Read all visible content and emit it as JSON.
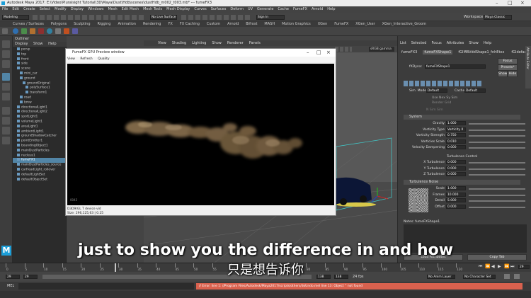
{
  "window": {
    "title": "Autodesk Maya 2017: E:\\Video\\Pluralsight Tutorial\\3D\\Maya\\Dust\\Hdb\\scenes\\dustHdb_m002_t003.mb* --- fumeFX3"
  },
  "menubar": {
    "items": [
      "File",
      "Edit",
      "Create",
      "Select",
      "Modify",
      "Display",
      "Windows",
      "Mesh",
      "Edit Mesh",
      "Mesh Tools",
      "Mesh Display",
      "Curves",
      "Surfaces",
      "Deform",
      "UV",
      "Generate",
      "Cache",
      "FumeFX",
      "Arnold",
      "Help"
    ],
    "workspace_label": "Workspace :",
    "workspace_value": "Maya Classic"
  },
  "statusline": {
    "mode": "Modeling",
    "live_surface": "No Live Surface",
    "sign_in": "Sign In"
  },
  "shelf": {
    "tabs": [
      "Curves / Surfaces",
      "Polygons",
      "Sculpting",
      "Rigging",
      "Animation",
      "Rendering",
      "FX",
      "FX Caching",
      "Custom",
      "Arnold",
      "Bifrost",
      "MASH",
      "Motion Graphics",
      "XGen",
      "FumeFX",
      "XGen_User",
      "XGen_Interactive_Groom"
    ]
  },
  "outliner": {
    "title": "Outliner",
    "menu": [
      "Display",
      "Show",
      "Help"
    ],
    "rows": [
      {
        "label": "persp",
        "indent": 1,
        "selected": false
      },
      {
        "label": "top",
        "indent": 1,
        "selected": false
      },
      {
        "label": "front",
        "indent": 1,
        "selected": false
      },
      {
        "label": "side",
        "indent": 1,
        "selected": false
      },
      {
        "label": "scene",
        "indent": 1,
        "selected": false
      },
      {
        "label": "mini_car",
        "indent": 2,
        "selected": false
      },
      {
        "label": "ground",
        "indent": 2,
        "selected": false
      },
      {
        "label": "groundOriginal",
        "indent": 3,
        "selected": false
      },
      {
        "label": "polySurface1",
        "indent": 4,
        "selected": false
      },
      {
        "label": "transform1",
        "indent": 4,
        "selected": false
      },
      {
        "label": "road",
        "indent": 2,
        "selected": false
      },
      {
        "label": "bmw",
        "indent": 2,
        "selected": false
      },
      {
        "label": "directionalLight1",
        "indent": 1,
        "selected": false
      },
      {
        "label": "directionalLight2",
        "indent": 1,
        "selected": false
      },
      {
        "label": "spotLight1",
        "indent": 1,
        "selected": false
      },
      {
        "label": "volumeLight1",
        "indent": 1,
        "selected": false
      },
      {
        "label": "areaLight1",
        "indent": 1,
        "selected": false
      },
      {
        "label": "ambientLight1",
        "indent": 1,
        "selected": false
      },
      {
        "label": "groundShadowCatcher",
        "indent": 1,
        "selected": false
      },
      {
        "label": "pointEmitter1",
        "indent": 1,
        "selected": false
      },
      {
        "label": "boundingObject1",
        "indent": 1,
        "selected": false
      },
      {
        "label": "mainDustParticles",
        "indent": 1,
        "selected": false
      },
      {
        "label": "nucleus1",
        "indent": 1,
        "selected": false
      },
      {
        "label": "fumeFX1",
        "indent": 1,
        "selected": true
      },
      {
        "label": "mainDustParticles_source",
        "indent": 1,
        "selected": false
      },
      {
        "label": "carHeadLight_rollover",
        "indent": 1,
        "selected": false
      },
      {
        "label": "defaultLightSet",
        "indent": 1,
        "selected": false
      },
      {
        "label": "defaultObjectSet",
        "indent": 1,
        "selected": false
      }
    ]
  },
  "viewport": {
    "menu": [
      "View",
      "Shading",
      "Lighting",
      "Show",
      "Renderer",
      "Panels"
    ],
    "badge": "sRGB gamma"
  },
  "preview": {
    "title": "FumeFX GPU Preview window",
    "menu": [
      "View",
      "Refresh",
      "Quality"
    ],
    "frame_label": "0043",
    "device": "D3D9/GL T device vid",
    "size": "Size: 296,125,63 | 0.25"
  },
  "attr": {
    "menu": [
      "List",
      "Selected",
      "Focus",
      "Attributes",
      "Show",
      "Help"
    ],
    "tabs": [
      "fumeFX3",
      "fumeFXShape1",
      "fGIMBVddShape1_fnhEtxx",
      "fGIdefaultMultfwdsx"
    ],
    "node_label": "fXDyna:",
    "node_value": "fumeFXShape1",
    "focus_btn": "Focus",
    "presets_btn": "Presets*",
    "show_btn": "Show",
    "hide_btn": "Hide",
    "side_tab": "Attribute Editor",
    "sim_mode_label": "Sim. Mode",
    "sim_mode_value": "Default",
    "cache_label": "Cache",
    "cache_value": "Default",
    "use_nex_label": "Use Nex Sy Sim",
    "render_grid_label": "Render Grid",
    "nex_sim_label": "N Sim Sim",
    "section_system": "System",
    "system_rows": [
      {
        "label": "Gravity",
        "value": "1.000"
      },
      {
        "label": "Vorticity Type",
        "value": "Vorticity II"
      },
      {
        "label": "Vorticity Strength",
        "value": "0.750"
      },
      {
        "label": "Vorticies Scale",
        "value": "0.010"
      },
      {
        "label": "Velocity Dampening",
        "value": "0.000"
      }
    ],
    "turbulence_noise_cb": "Turbulence Control",
    "turbulence_rows": [
      {
        "label": "X Turbulence",
        "value": "0.000"
      },
      {
        "label": "Y Turbulence",
        "value": "0.000"
      },
      {
        "label": "Z Turbulence",
        "value": "0.000"
      }
    ],
    "section_noise": "Turbulence Noise",
    "noise_rows": [
      {
        "label": "Scale",
        "value": "1.000"
      },
      {
        "label": "Frames",
        "value": "10.000"
      },
      {
        "label": "Detail",
        "value": "5.000"
      },
      {
        "label": "Offset",
        "value": "0.000"
      }
    ],
    "notes_label": "Notes: fumeFXShape1",
    "load_btn": "Load Attributes",
    "copy_btn": "Copy Tab"
  },
  "timeline": {
    "ticks": [
      "0",
      "5",
      "10",
      "15",
      "20",
      "25",
      "30",
      "35",
      "40",
      "45",
      "50",
      "55",
      "60",
      "65",
      "70",
      "75",
      "80",
      "85",
      "90",
      "95",
      "100",
      "105",
      "110",
      "115",
      "120"
    ],
    "current_frame": "29",
    "range_start": "29",
    "range_start2": "29",
    "range_end": "138",
    "range_end2": "138",
    "anim_layer": "No Anim Layer",
    "char_set": "No Character Set",
    "fps": "24 fps"
  },
  "cmdline": {
    "label": "MEL",
    "error": "// Error: line 1: //Program Files/Autodesk/Maya2017/scripts/others/doUndo.mel line 13: Object '' not found"
  },
  "subtitles": {
    "en": "just to show you the difference in and how",
    "cn": "只是想告诉你"
  },
  "colors": {
    "accent": "#5285a6",
    "error": "#d9614e",
    "maya_blue": "#1b9ed8"
  }
}
